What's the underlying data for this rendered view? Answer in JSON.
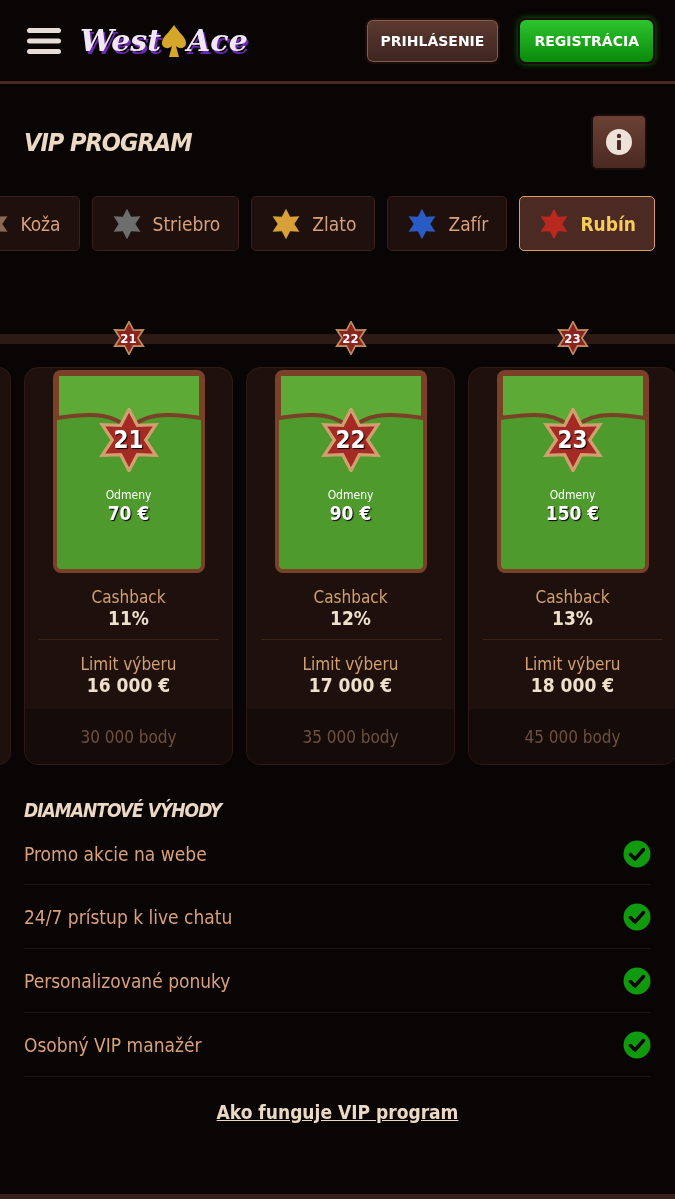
{
  "header": {
    "logo": {
      "word_1": "West",
      "word_2": "Ace"
    },
    "buttons": [
      {
        "label": "PRIHLÁSENIE",
        "kind": "login"
      },
      {
        "label": "REGISTRÁCIA",
        "kind": "register"
      }
    ]
  },
  "title": "VIP PROGRAM",
  "tabs": [
    {
      "label": "Koža",
      "color": "#8a6a55",
      "selected": false
    },
    {
      "label": "Striebro",
      "color": "#6e6e6e",
      "selected": false
    },
    {
      "label": "Zlato",
      "color": "#d9a03a",
      "selected": false
    },
    {
      "label": "Zafír",
      "color": "#2a5bc4",
      "selected": false
    },
    {
      "label": "Rubín",
      "color": "#b8281e",
      "selected": true
    }
  ],
  "levels": [
    {
      "marker_level": "21",
      "level": "21",
      "reward_label": "Odmeny",
      "reward": "70 €",
      "cashback_label": "Cashback",
      "cashback": "11%",
      "limit_label": "Limit výberu",
      "limit": "16 000 €",
      "points": "30 000 body"
    },
    {
      "marker_level": "22",
      "level": "22",
      "reward_label": "Odmeny",
      "reward": "90 €",
      "cashback_label": "Cashback",
      "cashback": "12%",
      "limit_label": "Limit výberu",
      "limit": "17 000 €",
      "points": "35 000 body"
    },
    {
      "marker_level": "23",
      "level": "23",
      "reward_label": "Odmeny",
      "reward": "150 €",
      "cashback_label": "Cashback",
      "cashback": "13%",
      "limit_label": "Limit výberu",
      "limit": "18 000 €",
      "points": "45 000 body"
    }
  ],
  "benefits": {
    "title": "DIAMANTOVÉ VÝHODY",
    "items": [
      {
        "label": "Promo akcie na webe",
        "checked": true
      },
      {
        "label": "24/7 prístup k live chatu",
        "checked": true
      },
      {
        "label": "Personalizované ponuky",
        "checked": true
      },
      {
        "label": "Osobný VIP manažér",
        "checked": true
      }
    ]
  },
  "link": "Ako funguje VIP program"
}
